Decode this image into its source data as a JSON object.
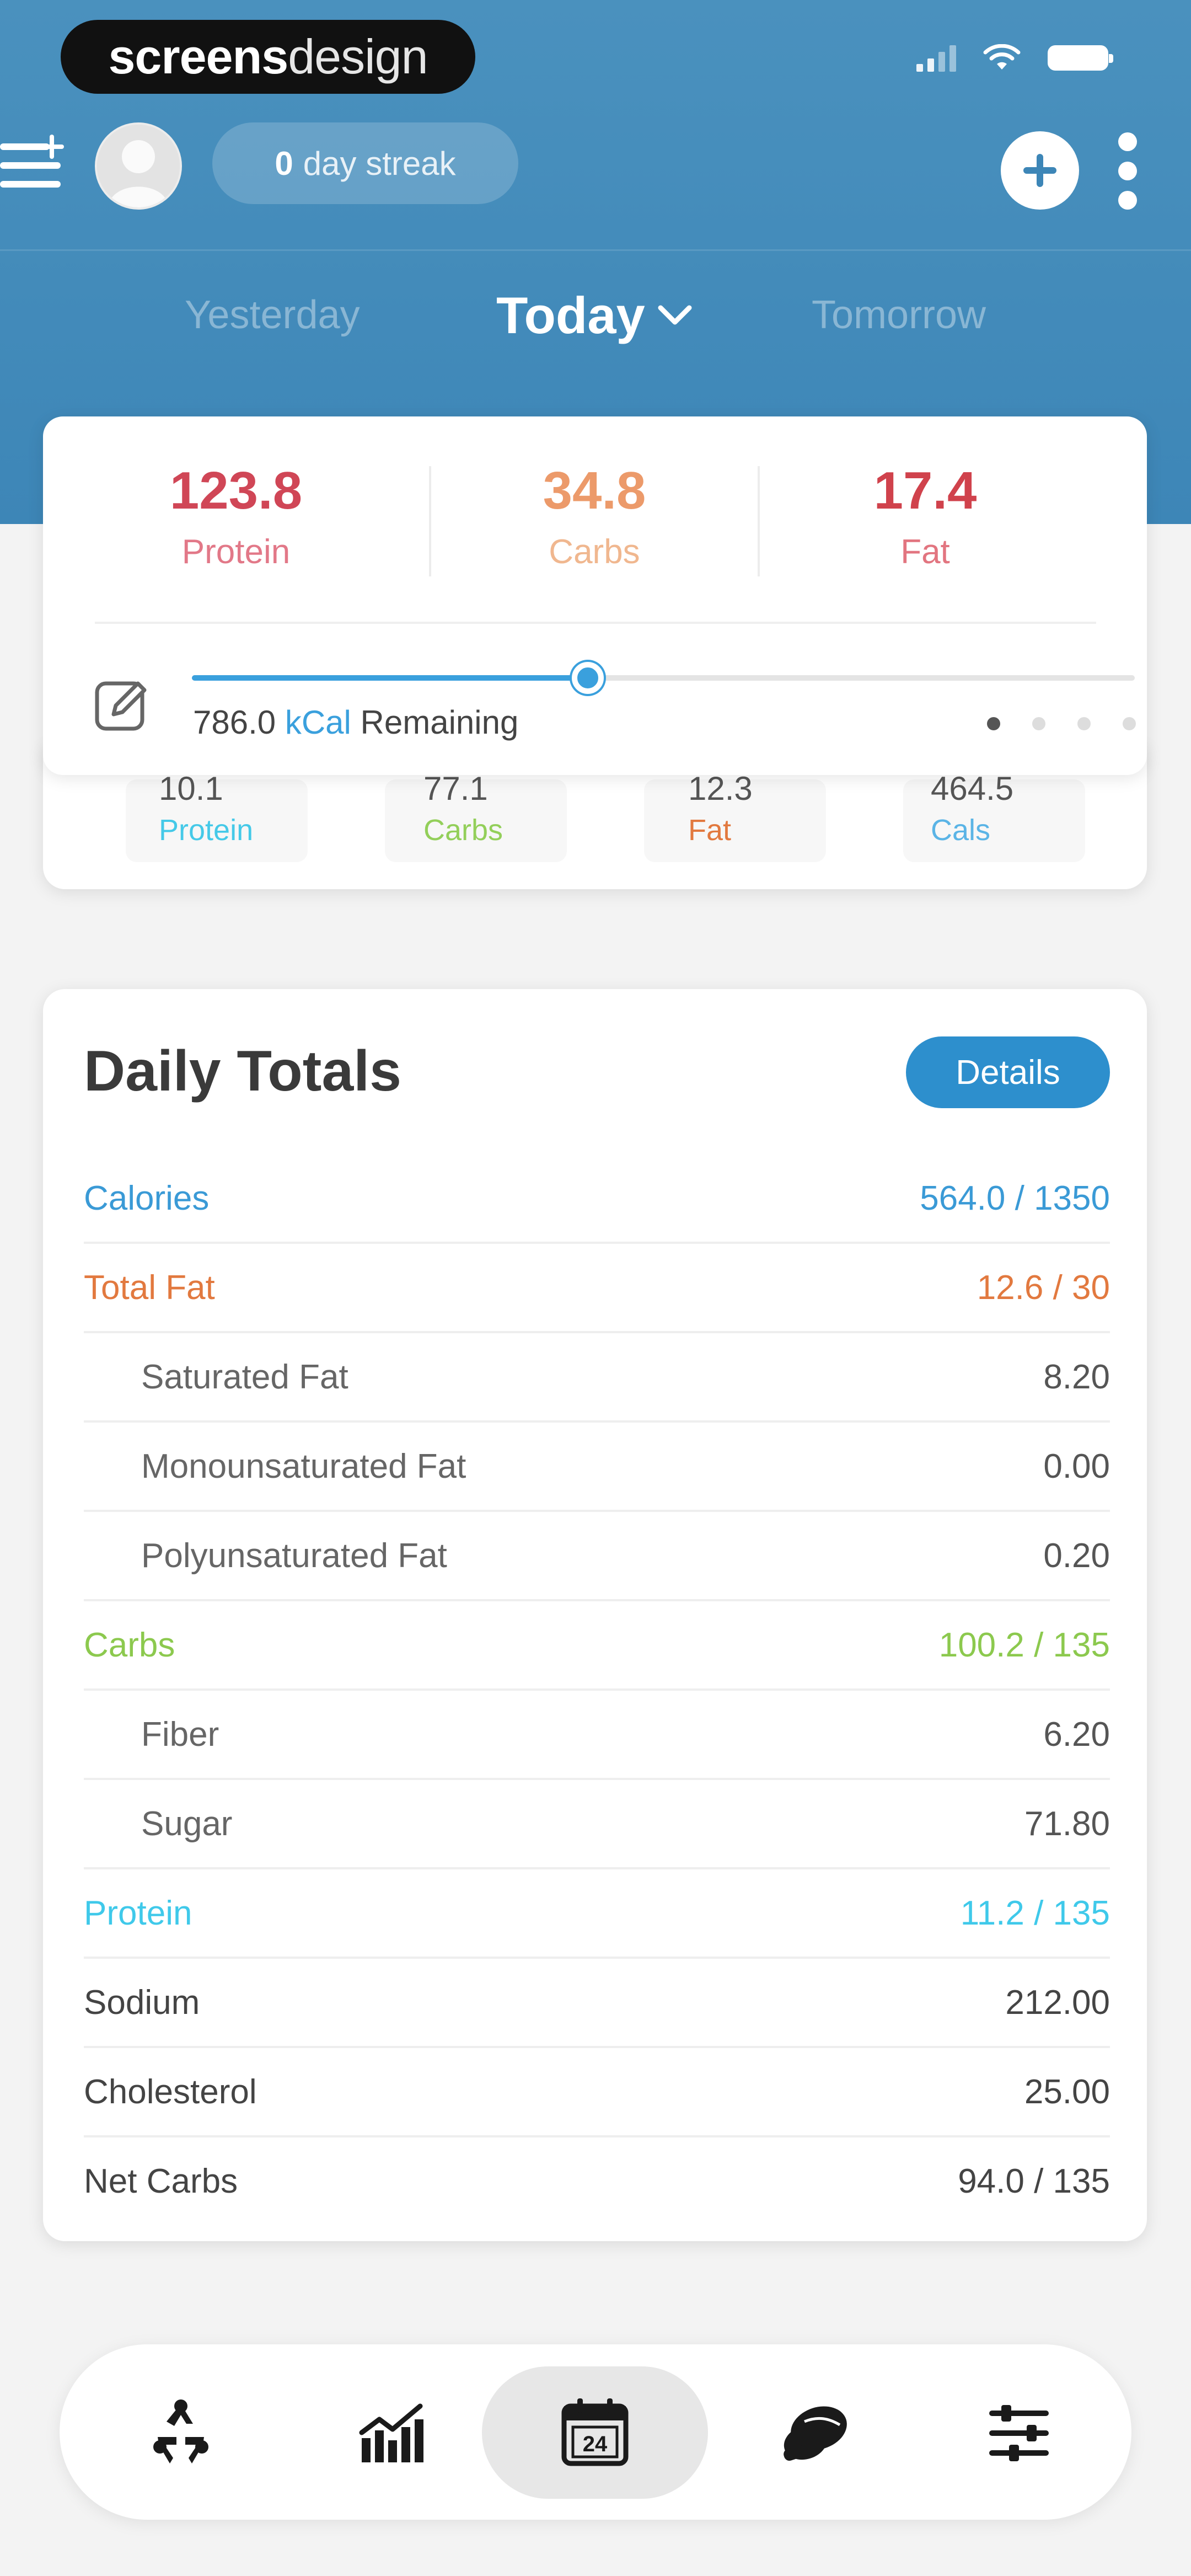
{
  "status_bar": {
    "brand_bold": "screens",
    "brand_light": "design"
  },
  "header": {
    "streak_count": "0",
    "streak_label": "day streak",
    "day_nav": {
      "prev": "Yesterday",
      "current": "Today",
      "next": "Tomorrow"
    }
  },
  "macros": {
    "protein": {
      "value": "123.8",
      "label": "Protein",
      "color": "#d04656"
    },
    "carbs": {
      "value": "34.8",
      "label": "Carbs",
      "color": "#ec9a6a"
    },
    "fat": {
      "value": "17.4",
      "label": "Fat",
      "color": "#d0424c"
    },
    "remaining_value": "786.0",
    "remaining_unit": "kCal",
    "remaining_label": "Remaining",
    "calorie_progress_fraction": 0.42,
    "page_dots": 4,
    "active_dot": 0
  },
  "meal_summary": [
    {
      "value": "10.1",
      "label": "Protein",
      "color": "#45c9e8"
    },
    {
      "value": "77.1",
      "label": "Carbs",
      "color": "#93cf5a"
    },
    {
      "value": "12.3",
      "label": "Fat",
      "color": "#e2793f"
    },
    {
      "value": "464.5",
      "label": "Cals",
      "color": "#5ab4e6"
    }
  ],
  "daily_totals": {
    "title": "Daily Totals",
    "details_label": "Details",
    "rows": [
      {
        "label": "Calories",
        "value": "564.0 / 1350",
        "color": "#3a9ad6",
        "sub": false
      },
      {
        "label": "Total Fat",
        "value": "12.6 / 30",
        "color": "#e2793f",
        "sub": false
      },
      {
        "label": "Saturated Fat",
        "value": "8.20",
        "color": "",
        "sub": true
      },
      {
        "label": "Monounsaturated Fat",
        "value": "0.00",
        "color": "",
        "sub": true
      },
      {
        "label": "Polyunsaturated Fat",
        "value": "0.20",
        "color": "",
        "sub": true
      },
      {
        "label": "Carbs",
        "value": "100.2 / 135",
        "color": "#8cc94e",
        "sub": false
      },
      {
        "label": "Fiber",
        "value": "6.20",
        "color": "",
        "sub": true
      },
      {
        "label": "Sugar",
        "value": "71.80",
        "color": "",
        "sub": true
      },
      {
        "label": "Protein",
        "value": "11.2 / 135",
        "color": "#3fc9ea",
        "sub": false
      },
      {
        "label": "Sodium",
        "value": "212.00",
        "color": "#444444",
        "sub": false
      },
      {
        "label": "Cholesterol",
        "value": "25.00",
        "color": "#444444",
        "sub": false
      },
      {
        "label": "Net Carbs",
        "value": "94.0 / 135",
        "color": "#444444",
        "sub": false
      }
    ]
  },
  "bottom_nav": {
    "items": [
      {
        "icon": "recycle-icon",
        "active": false
      },
      {
        "icon": "chart-icon",
        "active": false
      },
      {
        "icon": "calendar-icon",
        "active": true,
        "day": "24"
      },
      {
        "icon": "food-icon",
        "active": false
      },
      {
        "icon": "settings-sliders-icon",
        "active": false
      }
    ]
  },
  "colors": {
    "header_blue": "#4a91be",
    "accent_blue": "#2d8fcd",
    "progress_blue": "#3aa0dd"
  }
}
